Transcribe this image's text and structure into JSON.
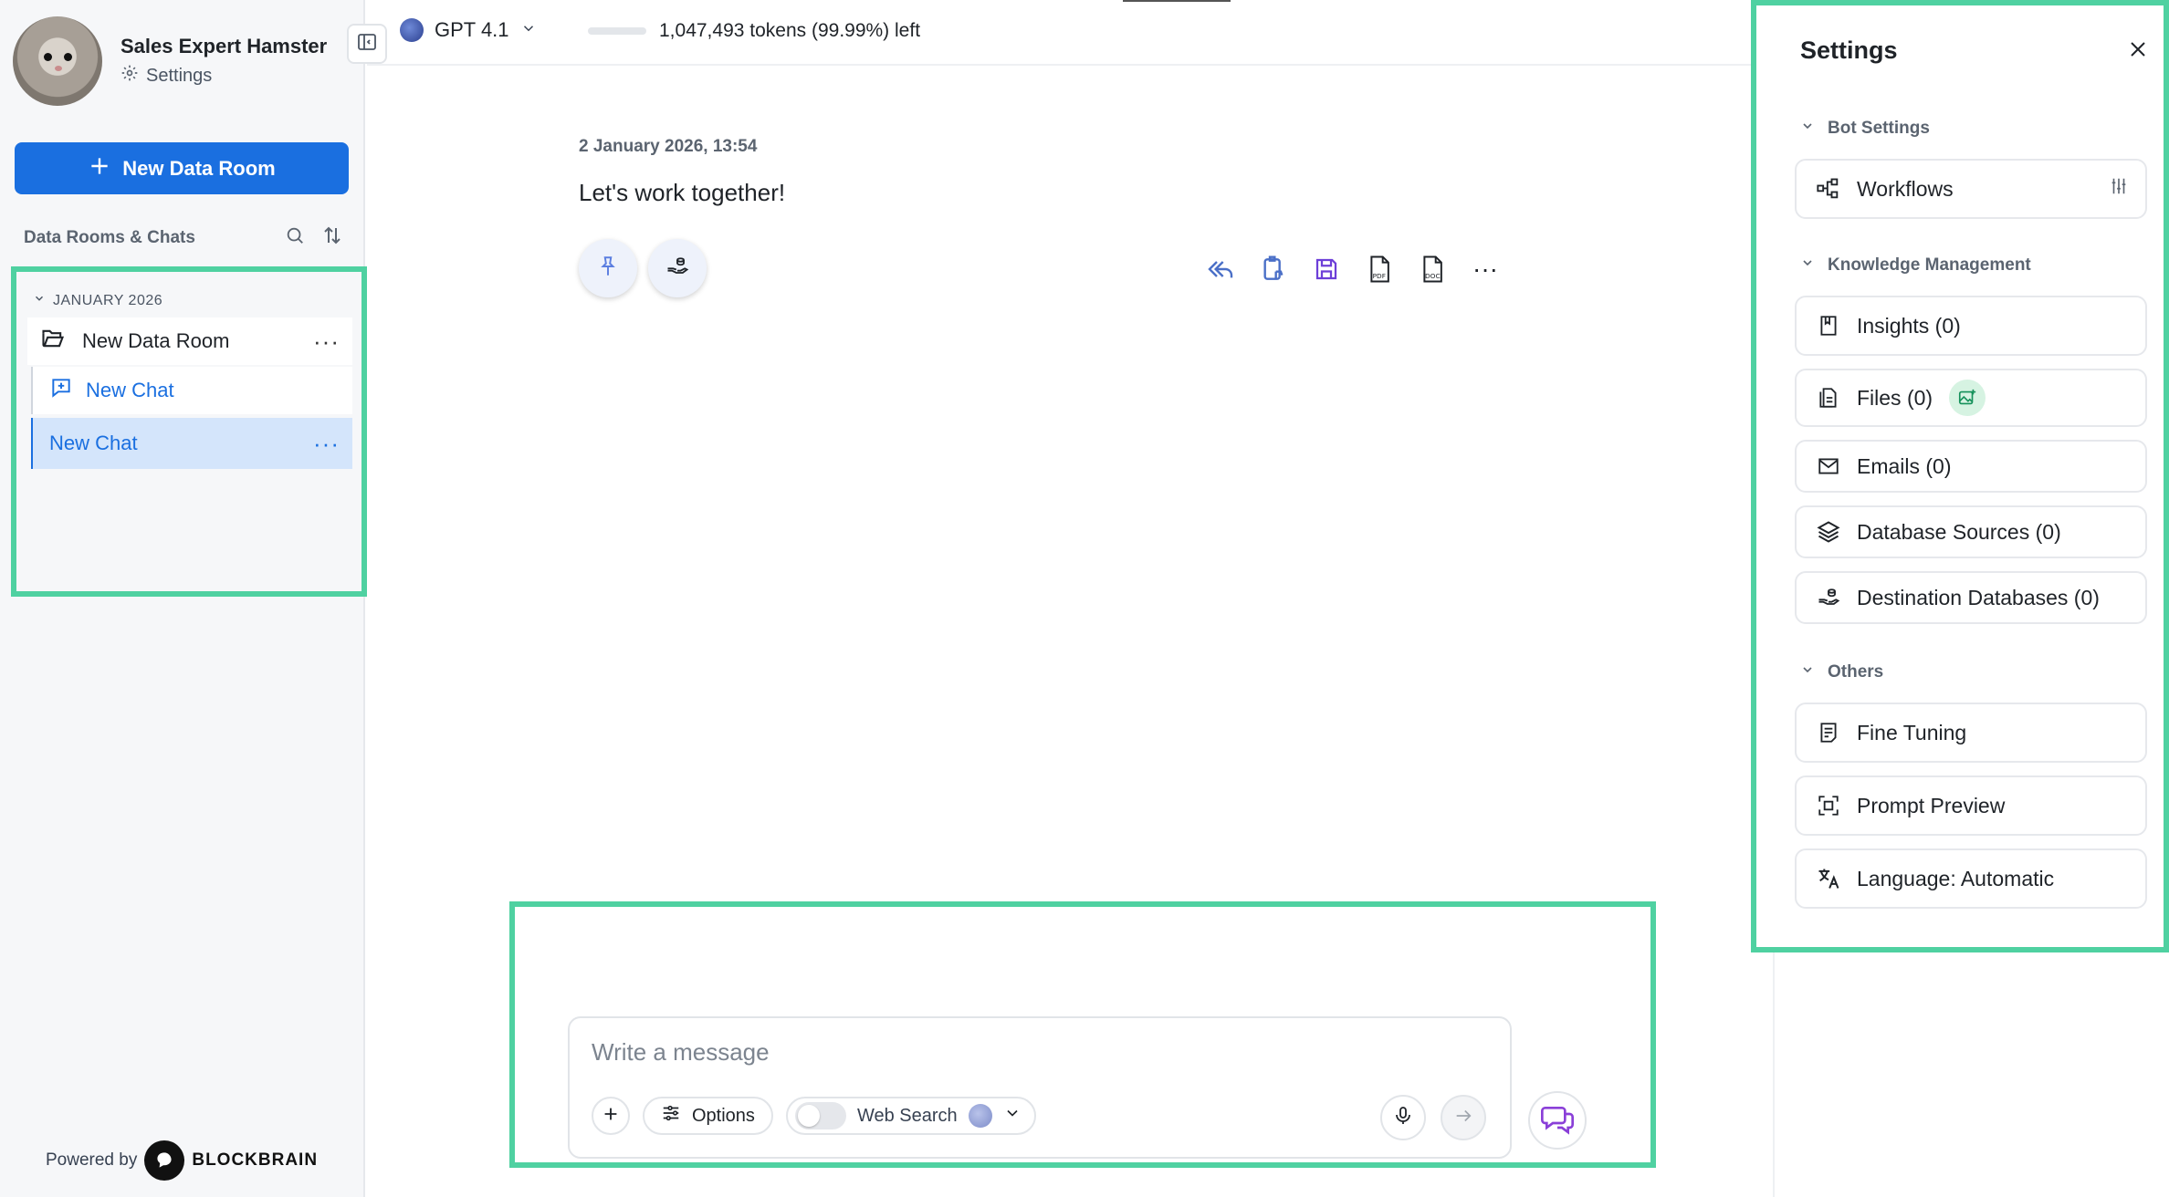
{
  "profile": {
    "name": "Sales Expert Hamster",
    "settings_label": "Settings"
  },
  "sidebar": {
    "new_room_label": "New Data Room",
    "section_label": "Data Rooms & Chats",
    "month": "JANUARY 2026",
    "room": {
      "label": "New Data Room"
    },
    "chats": [
      {
        "label": "New Chat"
      },
      {
        "label": "New Chat"
      }
    ],
    "powered_by": "Powered by",
    "brand": "BLOCKBRAIN"
  },
  "topbar": {
    "model": "GPT 4.1",
    "tokens": "1,047,493 tokens (99.99%) left"
  },
  "message": {
    "date": "2 January 2026, 13:54",
    "text": "Let's work together!"
  },
  "composer": {
    "placeholder": "Write a message",
    "options_label": "Options",
    "web_search_label": "Web Search"
  },
  "settings": {
    "title": "Settings",
    "groups": [
      {
        "label": "Bot Settings",
        "items": [
          {
            "label": "Workflows",
            "icon": "workflow-icon"
          }
        ]
      },
      {
        "label": "Knowledge Management",
        "items": [
          {
            "label": "Insights (0)",
            "icon": "bookmark-book-icon"
          },
          {
            "label": "Files (0)",
            "icon": "files-icon"
          },
          {
            "label": "Emails (0)",
            "icon": "mail-icon"
          },
          {
            "label": "Database Sources (0)",
            "icon": "layers-icon"
          },
          {
            "label": "Destination Databases (0)",
            "icon": "hand-database-icon"
          }
        ]
      },
      {
        "label": "Others",
        "items": [
          {
            "label": "Fine Tuning",
            "icon": "note-icon"
          },
          {
            "label": "Prompt Preview",
            "icon": "preview-frame-icon"
          },
          {
            "label": "Language: Automatic",
            "icon": "translate-icon"
          }
        ]
      }
    ]
  },
  "colors": {
    "accent": "#1a6fe0",
    "highlight_border": "#4fd1a1",
    "active_chat_bg": "#d4e5fb"
  }
}
